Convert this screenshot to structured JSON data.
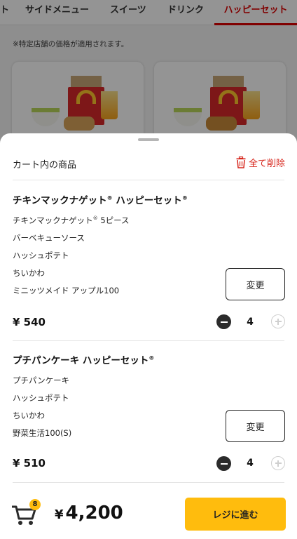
{
  "tabs": [
    {
      "label": "ト"
    },
    {
      "label": "サイドメニュー"
    },
    {
      "label": "スイーツ"
    },
    {
      "label": "ドリンク"
    },
    {
      "label": "ハッピーセット"
    }
  ],
  "notice": "※特定店舗の価格が適用されます。",
  "cart": {
    "title": "カート内の商品",
    "clear_all_label": "全て削除",
    "items": [
      {
        "name": "チキンマックナゲット",
        "name_mark": "®",
        "set_label": "ハッピーセット",
        "set_mark": "®",
        "components": [
          {
            "text": "チキンマックナゲット",
            "mark": "®",
            "suffix": "5ピース"
          },
          {
            "text": "バーベキューソース"
          },
          {
            "text": "ハッシュポテト"
          },
          {
            "text": "ちいかわ"
          },
          {
            "text": "ミニッツメイド アップル100"
          }
        ],
        "change_label": "変更",
        "currency": "¥",
        "price": "540",
        "quantity": "4"
      },
      {
        "name": "プチパンケーキ ハッピーセット",
        "name_mark": "®",
        "components": [
          {
            "text": "プチパンケーキ"
          },
          {
            "text": "ハッシュポテト"
          },
          {
            "text": "ちいかわ"
          },
          {
            "text": "野菜生活100(S)"
          }
        ],
        "change_label": "変更",
        "currency": "¥",
        "price": "510",
        "quantity": "4"
      }
    ]
  },
  "footer": {
    "cart_count": "8",
    "currency": "¥",
    "total": "4,200",
    "checkout_label": "レジに進む"
  },
  "colors": {
    "accent_red": "#d7261c",
    "button_yellow": "#ffbc0d"
  }
}
